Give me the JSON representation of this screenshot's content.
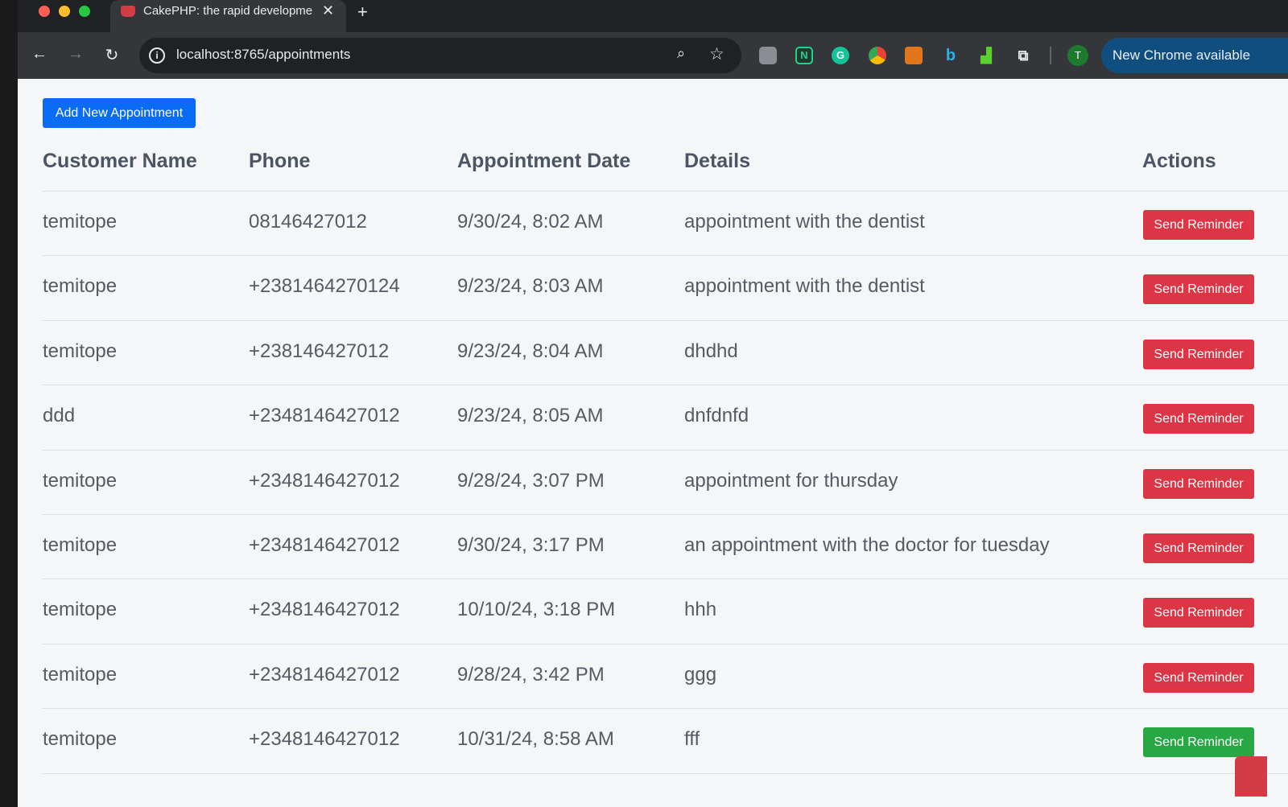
{
  "browser": {
    "tab_title": "CakePHP: the rapid development",
    "tab_close": "✕",
    "new_tab": "+",
    "url": "localhost:8765/appointments",
    "profile_initial": "T",
    "update_label": "New Chrome available",
    "icons": {
      "back": "arrow-left-icon",
      "forward": "arrow-right-icon",
      "reload": "reload-icon",
      "site_info": "info-icon",
      "zoom": "zoom-icon",
      "bookmark": "star-icon"
    }
  },
  "page": {
    "add_button_label": "Add New Appointment",
    "columns": [
      "Customer Name",
      "Phone",
      "Appointment Date",
      "Details",
      "Actions"
    ],
    "action_label": "Send Reminder",
    "colors": {
      "primary": "#0a6cf5",
      "danger": "#dc3545",
      "success": "#28a745"
    },
    "rows": [
      {
        "name": "temitope",
        "phone": "08146427012",
        "date": "9/30/24, 8:02 AM",
        "details": "appointment with the dentist",
        "action_state": "danger"
      },
      {
        "name": "temitope",
        "phone": "+2381464270124",
        "date": "9/23/24, 8:03 AM",
        "details": "appointment with the dentist",
        "action_state": "danger"
      },
      {
        "name": "temitope",
        "phone": "+238146427012",
        "date": "9/23/24, 8:04 AM",
        "details": "dhdhd",
        "action_state": "danger"
      },
      {
        "name": "ddd",
        "phone": "+2348146427012",
        "date": "9/23/24, 8:05 AM",
        "details": "dnfdnfd",
        "action_state": "danger"
      },
      {
        "name": "temitope",
        "phone": "+2348146427012",
        "date": "9/28/24, 3:07 PM",
        "details": "appointment for thursday",
        "action_state": "danger"
      },
      {
        "name": "temitope",
        "phone": "+2348146427012",
        "date": "9/30/24, 3:17 PM",
        "details": "an appointment with the doctor for tuesday",
        "action_state": "danger"
      },
      {
        "name": "temitope",
        "phone": "+2348146427012",
        "date": "10/10/24, 3:18 PM",
        "details": "hhh",
        "action_state": "danger"
      },
      {
        "name": "temitope",
        "phone": "+2348146427012",
        "date": "9/28/24, 3:42 PM",
        "details": "ggg",
        "action_state": "danger"
      },
      {
        "name": "temitope",
        "phone": "+2348146427012",
        "date": "10/31/24, 8:58 AM",
        "details": "fff",
        "action_state": "success"
      }
    ]
  }
}
